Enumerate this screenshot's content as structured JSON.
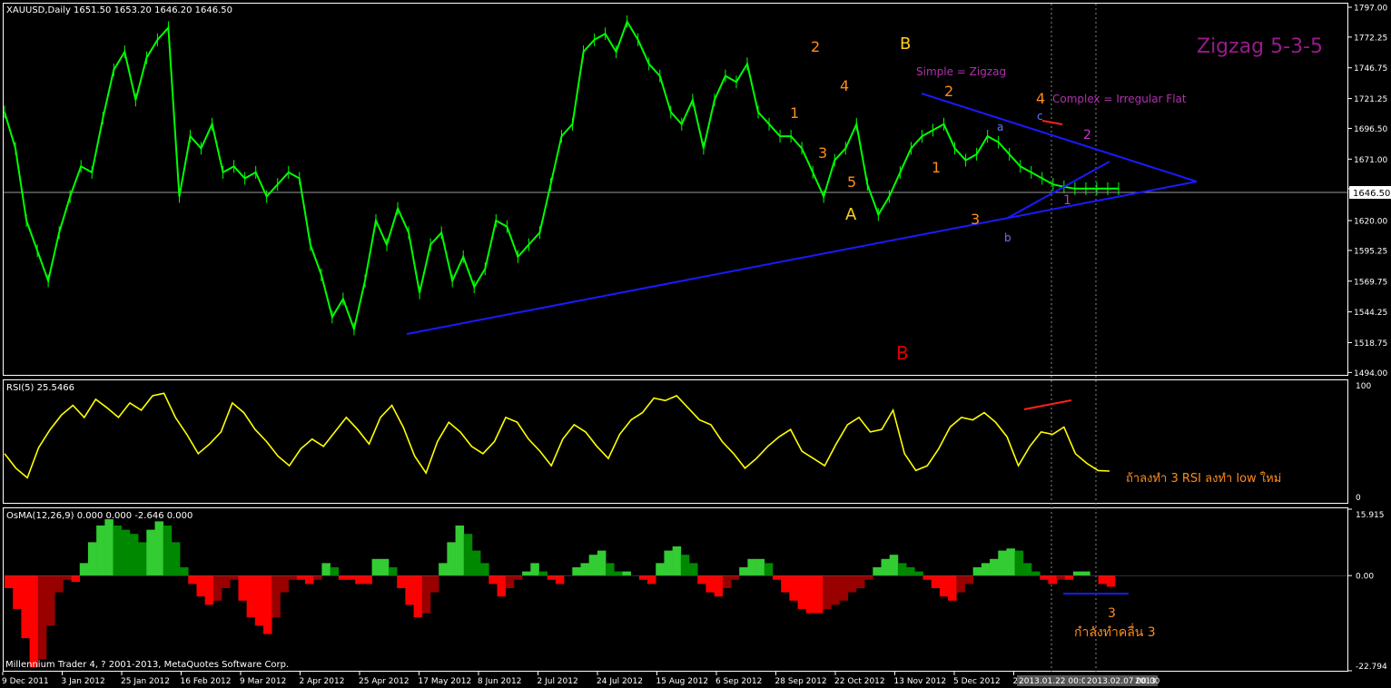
{
  "colors": {
    "background": "#000000",
    "frame": "#ffffff",
    "price_line": "#00ff00",
    "trendline": "#1a1aff",
    "rsi_line": "#ffff00",
    "osma_pos_bright": "#33cc33",
    "osma_pos_dark": "#008800",
    "osma_neg_bright": "#ff0000",
    "osma_neg_dark": "#990000",
    "wave_orange": "#ff8c1a",
    "wave_yellow": "#ffd21a",
    "wave_red": "#dd0000",
    "wave_purple": "#cc33cc",
    "wave_blue": "#6677ff",
    "title_purple": "#9a1a8c"
  },
  "main_panel": {
    "header": "XAUUSD,Daily  1651.50 1653.20 1646.20 1646.50",
    "title": "Zigzag 5-3-5",
    "current_price_label": "1646.50"
  },
  "rsi_panel": {
    "header": "RSI(5) 25.5466",
    "note": "ถ้าลงทำ 3 RSI ลงทำ low ใหม่"
  },
  "osma_panel": {
    "header": "OsMA(12,26,9) 0.000 0.000 -2.646 0.000",
    "note_wave": "3",
    "note": "กำลังทำคลื่น 3"
  },
  "footer": {
    "copyright": "Millennium Trader 4, ? 2001-2013, MetaQuotes Software Corp."
  },
  "annotations": [
    {
      "text": "2",
      "color": "orange"
    },
    {
      "text": "1",
      "color": "orange"
    },
    {
      "text": "3",
      "color": "orange"
    },
    {
      "text": "4",
      "color": "orange"
    },
    {
      "text": "5",
      "color": "orange"
    },
    {
      "text": "A",
      "color": "yellow"
    },
    {
      "text": "B",
      "color": "yellow"
    },
    {
      "text": "Simple = Zigzag",
      "color": "purple"
    },
    {
      "text": "2",
      "color": "orange"
    },
    {
      "text": "1",
      "color": "orange"
    },
    {
      "text": "3",
      "color": "orange"
    },
    {
      "text": "4",
      "color": "orange"
    },
    {
      "text": "Complex = Irregular Flat",
      "color": "purple"
    },
    {
      "text": "a",
      "color": "blue"
    },
    {
      "text": "b",
      "color": "blue"
    },
    {
      "text": "c",
      "color": "blue"
    },
    {
      "text": "2",
      "color": "purple"
    },
    {
      "text": "1",
      "color": "purple"
    },
    {
      "text": "B",
      "color": "red"
    }
  ],
  "chart_data": [
    {
      "type": "line",
      "symbol": "XAUUSD",
      "timeframe": "Daily",
      "ohlc_header": {
        "open": 1651.5,
        "high": 1653.2,
        "low": 1646.2,
        "close": 1646.5
      },
      "y_ticks": [
        1797.0,
        1772.25,
        1746.75,
        1721.25,
        1696.5,
        1671.0,
        1646.5,
        1620.0,
        1595.25,
        1569.75,
        1544.25,
        1518.75,
        1494.0
      ],
      "ylim": [
        1492,
        1800
      ],
      "x_ticks": [
        "9 Dec 2011",
        "3 Jan 2012",
        "25 Jan 2012",
        "16 Feb 2012",
        "9 Mar 2012",
        "2 Apr 2012",
        "25 Apr 2012",
        "17 May 2012",
        "8 Jun 2012",
        "2 Jul 2012",
        "24 Jul 2012",
        "15 Aug 2012",
        "6 Sep 2012",
        "28 Sep 2012",
        "22 Oct 2012",
        "13 Nov 2012",
        "5 Dec 2012",
        "27 Dec 2012",
        "2013.01.22 00:00",
        "2013.02.07 00:00",
        "2013"
      ],
      "series": [
        {
          "x": [
            0,
            3,
            6,
            9,
            12,
            15,
            18,
            21,
            24,
            27,
            30,
            33,
            36,
            39,
            42,
            45,
            48,
            51,
            54,
            57,
            60,
            63,
            66,
            69,
            72,
            75,
            78,
            81,
            84,
            87,
            90,
            93,
            96,
            99,
            102,
            105,
            108,
            111,
            114,
            117,
            120,
            123,
            126,
            129,
            132,
            135,
            138,
            141,
            144,
            147,
            150,
            153,
            156,
            159,
            162,
            165,
            168,
            171,
            174,
            177,
            180,
            183,
            186,
            189,
            192,
            195,
            198,
            201,
            204,
            207,
            210,
            213,
            216,
            219,
            222,
            225,
            228,
            231,
            234,
            237,
            240,
            243,
            246,
            249,
            252,
            255,
            258,
            261,
            264,
            267,
            270,
            273,
            276,
            279,
            282,
            285,
            288,
            291,
            294,
            297,
            300,
            303,
            306
          ],
          "values": [
            1710,
            1680,
            1620,
            1595,
            1570,
            1610,
            1640,
            1665,
            1660,
            1705,
            1745,
            1760,
            1720,
            1755,
            1770,
            1780,
            1640,
            1690,
            1680,
            1700,
            1660,
            1665,
            1655,
            1660,
            1640,
            1650,
            1660,
            1655,
            1600,
            1575,
            1540,
            1555,
            1530,
            1570,
            1620,
            1600,
            1630,
            1610,
            1560,
            1600,
            1610,
            1570,
            1590,
            1565,
            1580,
            1620,
            1615,
            1590,
            1600,
            1610,
            1650,
            1690,
            1700,
            1760,
            1770,
            1775,
            1760,
            1785,
            1770,
            1750,
            1740,
            1710,
            1700,
            1720,
            1680,
            1720,
            1740,
            1735,
            1750,
            1710,
            1700,
            1690,
            1690,
            1680,
            1660,
            1640,
            1670,
            1680,
            1700,
            1650,
            1625,
            1640,
            1660,
            1680,
            1690,
            1695,
            1700,
            1680,
            1670,
            1675,
            1690,
            1685,
            1675,
            1665,
            1660,
            1655,
            1650,
            1648,
            1646.5,
            1646.5,
            1646.5,
            1646.5,
            1646.5
          ]
        }
      ]
    },
    {
      "type": "line",
      "name": "RSI(5)",
      "current_value": 25.5466,
      "ylim": [
        0,
        100
      ],
      "y_ticks": [
        100,
        0
      ],
      "series": [
        {
          "values": [
            40,
            28,
            20,
            45,
            60,
            72,
            80,
            70,
            85,
            78,
            70,
            82,
            76,
            88,
            90,
            70,
            56,
            40,
            48,
            58,
            82,
            74,
            60,
            50,
            38,
            30,
            44,
            52,
            46,
            58,
            70,
            60,
            48,
            70,
            80,
            62,
            38,
            24,
            50,
            66,
            58,
            46,
            40,
            50,
            70,
            66,
            52,
            42,
            30,
            52,
            64,
            58,
            46,
            36,
            56,
            68,
            74,
            86,
            84,
            88,
            78,
            68,
            64,
            50,
            40,
            28,
            36,
            46,
            54,
            60,
            42,
            36,
            30,
            48,
            64,
            70,
            58,
            60,
            76,
            40,
            26,
            30,
            44,
            62,
            70,
            68,
            74,
            66,
            54,
            30,
            46,
            58,
            56,
            62,
            40,
            32,
            26,
            25.5466
          ]
        }
      ]
    },
    {
      "type": "bar",
      "name": "OsMA(12,26,9)",
      "header_values": [
        0.0,
        0.0,
        -2.646,
        0.0
      ],
      "ylim": [
        -22.794,
        15.915
      ],
      "y_ticks": [
        15.915,
        0.0,
        -22.794
      ],
      "series": [
        {
          "values": [
            -3,
            -8,
            -15,
            -22,
            -20,
            -12,
            -4,
            -1,
            -1.5,
            3,
            8,
            12,
            13.5,
            12,
            11,
            10,
            8,
            11,
            13,
            12,
            8,
            2,
            -2,
            -5,
            -7,
            -6,
            -3,
            -1,
            -6,
            -10,
            -12,
            -14,
            -10,
            -4,
            -1,
            -1,
            -2,
            -1,
            3,
            2,
            -1,
            -1,
            -2,
            -2,
            4,
            4,
            2,
            -3,
            -7,
            -10,
            -9,
            -4,
            3,
            8,
            12,
            10,
            6,
            3,
            -2,
            -5,
            -3,
            -1,
            1,
            3,
            1,
            -1,
            -2,
            0,
            2,
            3,
            5,
            6,
            3,
            1,
            1,
            0,
            -1,
            -2,
            3,
            6,
            7,
            5,
            3,
            -2,
            -4,
            -5,
            -3,
            -1,
            2,
            4,
            4,
            3,
            -1,
            -4,
            -6,
            -8,
            -9,
            -9,
            -8,
            -7,
            -6,
            -4,
            -3,
            -1,
            2,
            4,
            5,
            3,
            2,
            1,
            -1,
            -3,
            -5,
            -6,
            -4,
            -2,
            2,
            3,
            4,
            6,
            6.5,
            6,
            3,
            1,
            -1,
            -2,
            -1,
            -1,
            1,
            1,
            0,
            -2,
            -2.646
          ]
        }
      ]
    }
  ]
}
